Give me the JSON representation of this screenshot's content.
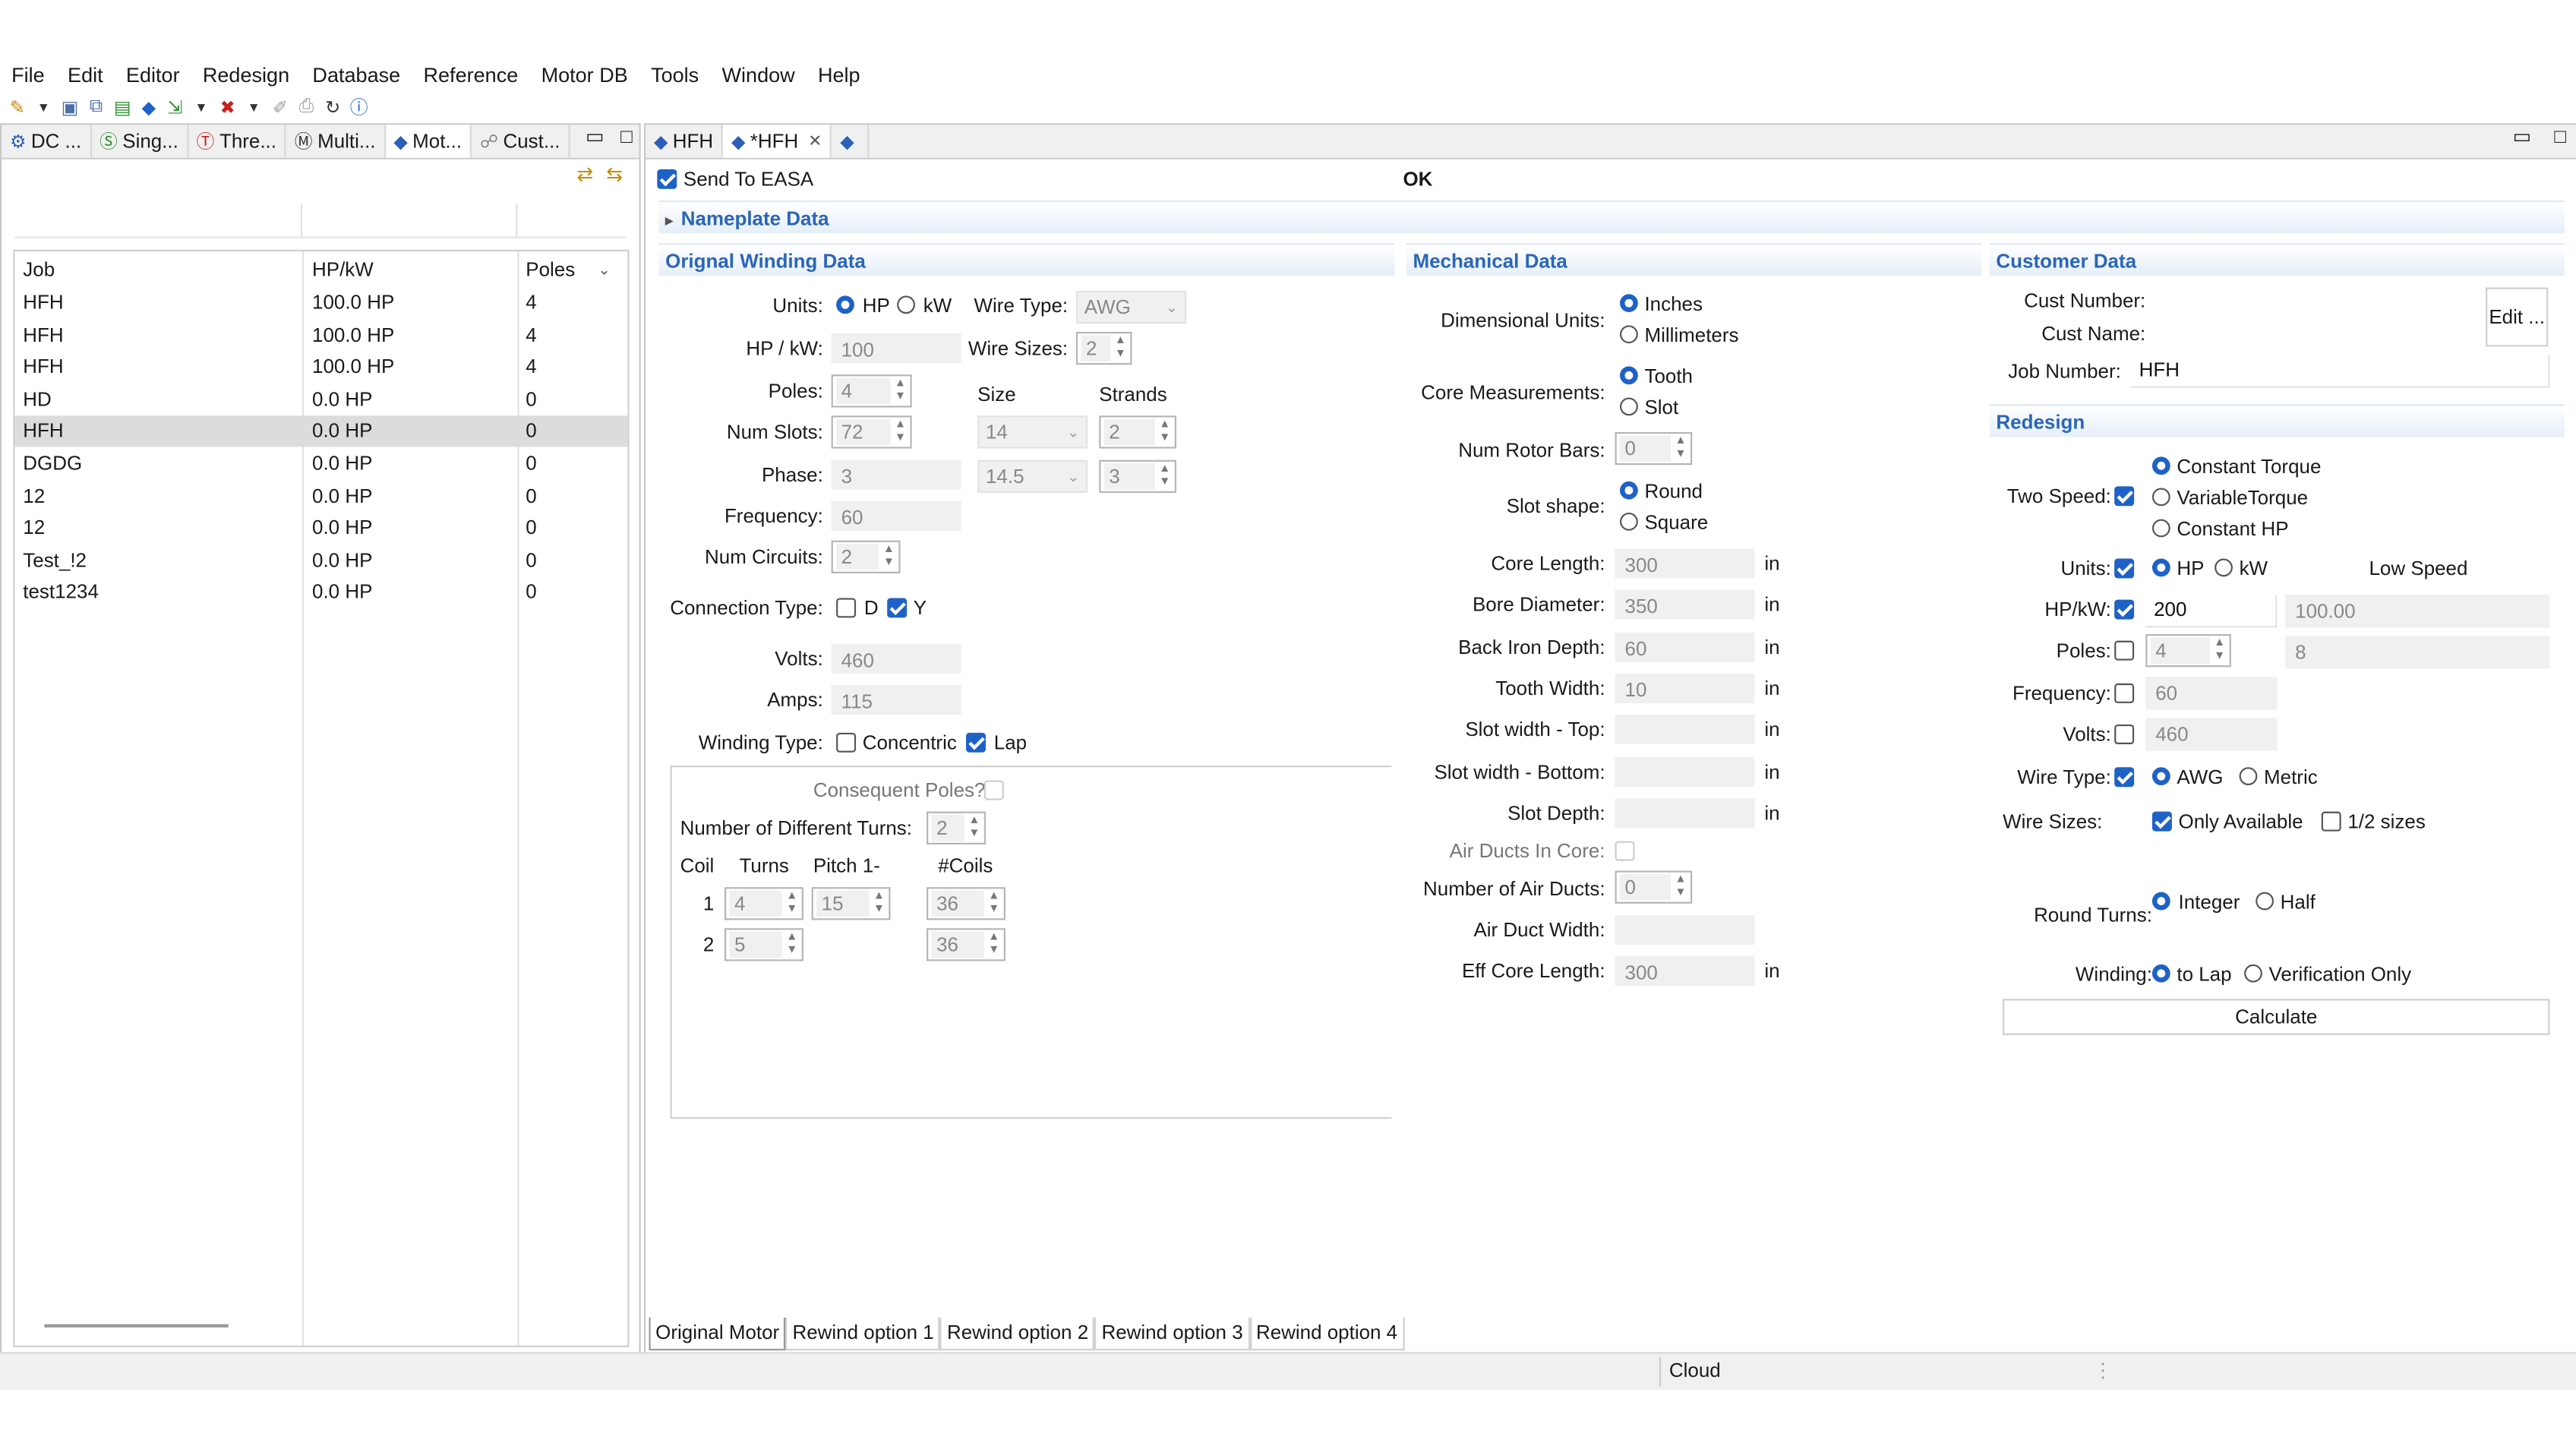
{
  "menu": [
    "File",
    "Edit",
    "Editor",
    "Redesign",
    "Database",
    "Reference",
    "Motor DB",
    "Tools",
    "Window",
    "Help"
  ],
  "left_tabs": [
    {
      "icon": "dc-icon",
      "label": "DC ..."
    },
    {
      "icon": "single-phase-icon",
      "label": "Sing..."
    },
    {
      "icon": "three-phase-icon",
      "label": "Thre..."
    },
    {
      "icon": "multi-icon",
      "label": "Multi..."
    },
    {
      "icon": "motor-icon",
      "label": "Mot..."
    },
    {
      "icon": "customer-icon",
      "label": "Cust..."
    }
  ],
  "job_table": {
    "headers": [
      "Job",
      "HP/kW",
      "Poles"
    ],
    "rows": [
      [
        "HFH",
        "100.0 HP",
        "4"
      ],
      [
        "HFH",
        "100.0 HP",
        "4"
      ],
      [
        "HFH",
        "100.0 HP",
        "4"
      ],
      [
        "HD",
        "0.0 HP",
        "0"
      ],
      [
        "HFH",
        "0.0 HP",
        "0"
      ],
      [
        "DGDG",
        "0.0 HP",
        "0"
      ],
      [
        "12",
        "0.0 HP",
        "0"
      ],
      [
        "12",
        "0.0 HP",
        "0"
      ],
      [
        "Test_!2",
        "0.0 HP",
        "0"
      ],
      [
        "test1234",
        "0.0 HP",
        "0"
      ]
    ],
    "selected_row": 4
  },
  "editor_tabs": [
    "HFH",
    "*HFH",
    ""
  ],
  "send_to_easa": {
    "label": "Send To EASA",
    "checked": true
  },
  "status_ok": "OK",
  "nameplate_section": "Nameplate Data",
  "winding": {
    "title": "Orignal Winding Data",
    "units_label": "Units:",
    "units_hp": "HP",
    "units_kw": "kW",
    "wire_type_label": "Wire Type:",
    "wire_type_value": "AWG",
    "hpkw_label": "HP / kW:",
    "hpkw_value": "100",
    "wire_sizes_label": "Wire Sizes:",
    "wire_sizes_value": "2",
    "poles_label": "Poles:",
    "poles_value": "4",
    "size_label": "Size",
    "strands_label": "Strands",
    "num_slots_label": "Num Slots:",
    "num_slots_value": "72",
    "size1": "14",
    "strands1": "2",
    "phase_label": "Phase:",
    "phase_value": "3",
    "size2": "14.5",
    "strands2": "3",
    "frequency_label": "Frequency:",
    "frequency_value": "60",
    "num_circuits_label": "Num Circuits:",
    "num_circuits_value": "2",
    "connection_label": "Connection Type:",
    "connection_d": "D",
    "connection_y": "Y",
    "volts_label": "Volts:",
    "volts_value": "460",
    "amps_label": "Amps:",
    "amps_value": "115",
    "winding_type_label": "Winding Type:",
    "concentric": "Concentric",
    "lap": "Lap",
    "consequent_poles": "Consequent Poles?",
    "num_diff_turns_label": "Number of Different Turns:",
    "num_diff_turns_value": "2",
    "coil_headers": [
      "Coil",
      "Turns",
      "Pitch 1-",
      "#Coils"
    ],
    "coils": [
      {
        "coil": "1",
        "turns": "4",
        "pitch": "15",
        "coils": "36"
      },
      {
        "coil": "2",
        "turns": "5",
        "pitch": "",
        "coils": "36"
      }
    ]
  },
  "mechanical": {
    "title": "Mechanical Data",
    "dim_units_label": "Dimensional Units:",
    "inches": "Inches",
    "millimeters": "Millimeters",
    "core_meas_label": "Core Measurements:",
    "tooth": "Tooth",
    "slot": "Slot",
    "rotor_bars_label": "Num Rotor Bars:",
    "rotor_bars_value": "0",
    "slot_shape_label": "Slot shape:",
    "round": "Round",
    "square": "Square",
    "unit": "in",
    "core_length_label": "Core Length:",
    "core_length_value": "300",
    "bore_label": "Bore Diameter:",
    "bore_value": "350",
    "back_iron_label": "Back Iron Depth:",
    "back_iron_value": "60",
    "tooth_width_label": "Tooth Width:",
    "tooth_width_value": "10",
    "slot_top_label": "Slot width - Top:",
    "slot_bottom_label": "Slot width - Bottom:",
    "slot_depth_label": "Slot Depth:",
    "air_ducts_in_core_label": "Air Ducts In Core:",
    "num_air_ducts_label": "Number of Air Ducts:",
    "num_air_ducts_value": "0",
    "air_duct_width_label": "Air Duct Width:",
    "eff_core_label": "Eff Core Length:",
    "eff_core_value": "300"
  },
  "customer": {
    "title": "Customer Data",
    "cust_number_label": "Cust Number:",
    "cust_name_label": "Cust Name:",
    "job_number_label": "Job Number:",
    "job_number_value": "HFH",
    "edit_button": "Edit ..."
  },
  "redesign": {
    "title": "Redesign",
    "two_speed_label": "Two Speed:",
    "constant_torque": "Constant Torque",
    "variable_torque": "VariableTorque",
    "constant_hp": "Constant HP",
    "units_label": "Units:",
    "hp": "HP",
    "kw": "kW",
    "low_speed": "Low Speed",
    "hpkw_label": "HP/kW:",
    "hpkw_value": "200",
    "hpkw_low": "100.00",
    "poles_label": "Poles:",
    "poles_value": "4",
    "poles_low": "8",
    "frequency_label": "Frequency:",
    "frequency_value": "60",
    "volts_label": "Volts:",
    "volts_value": "460",
    "wire_type_label": "Wire Type:",
    "awg": "AWG",
    "metric": "Metric",
    "wire_sizes_label": "Wire Sizes:",
    "only_available": "Only Available",
    "half_sizes": "1/2 sizes",
    "round_turns_label": "Round Turns:",
    "integer": "Integer",
    "half": "Half",
    "winding_label": "Winding:",
    "to_lap": "to Lap",
    "verification_only": "Verification Only",
    "calculate": "Calculate"
  },
  "bottom_tabs": [
    "Original Motor",
    "Rewind option 1",
    "Rewind option 2",
    "Rewind option 3",
    "Rewind option 4"
  ],
  "status_bar": {
    "cloud": "Cloud"
  },
  "colors": {
    "accent": "#1e62c8",
    "section_text": "#2a66b8",
    "selected_row": "#dcdcdc"
  }
}
